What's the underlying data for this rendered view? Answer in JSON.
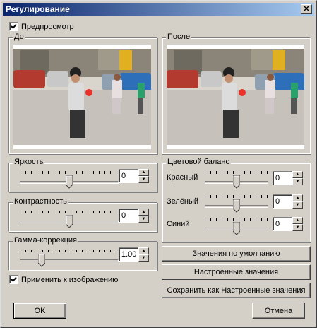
{
  "window": {
    "title": "Регулирование",
    "close_glyph": "✕"
  },
  "preview_toggle": {
    "label": "Предпросмотр",
    "checked": true
  },
  "before": {
    "label": "До"
  },
  "after": {
    "label": "После"
  },
  "brightness": {
    "label": "Яркость",
    "value": "0",
    "level": 0.5
  },
  "contrast": {
    "label": "Контрастность",
    "value": "0",
    "level": 0.5
  },
  "gamma": {
    "label": "Гамма-коррекция",
    "value": "1.00",
    "level": 0.2
  },
  "apply_toggle": {
    "label": "Применить к изображению",
    "checked": true
  },
  "color_balance": {
    "label": "Цветовой баланс",
    "red": {
      "label": "Красный",
      "value": "0",
      "level": 0.5
    },
    "green": {
      "label": "Зелёный",
      "value": "0",
      "level": 0.5
    },
    "blue": {
      "label": "Синий",
      "value": "0",
      "level": 0.5
    }
  },
  "buttons": {
    "defaults": "Значения по умолчанию",
    "custom": "Настроенные значения",
    "save_custom": "Сохранить как Настроенные значения",
    "ok": "OK",
    "cancel": "Отмена"
  },
  "icons": {
    "checkmark": "check-icon",
    "spin_up": "▲",
    "spin_down": "▼"
  }
}
